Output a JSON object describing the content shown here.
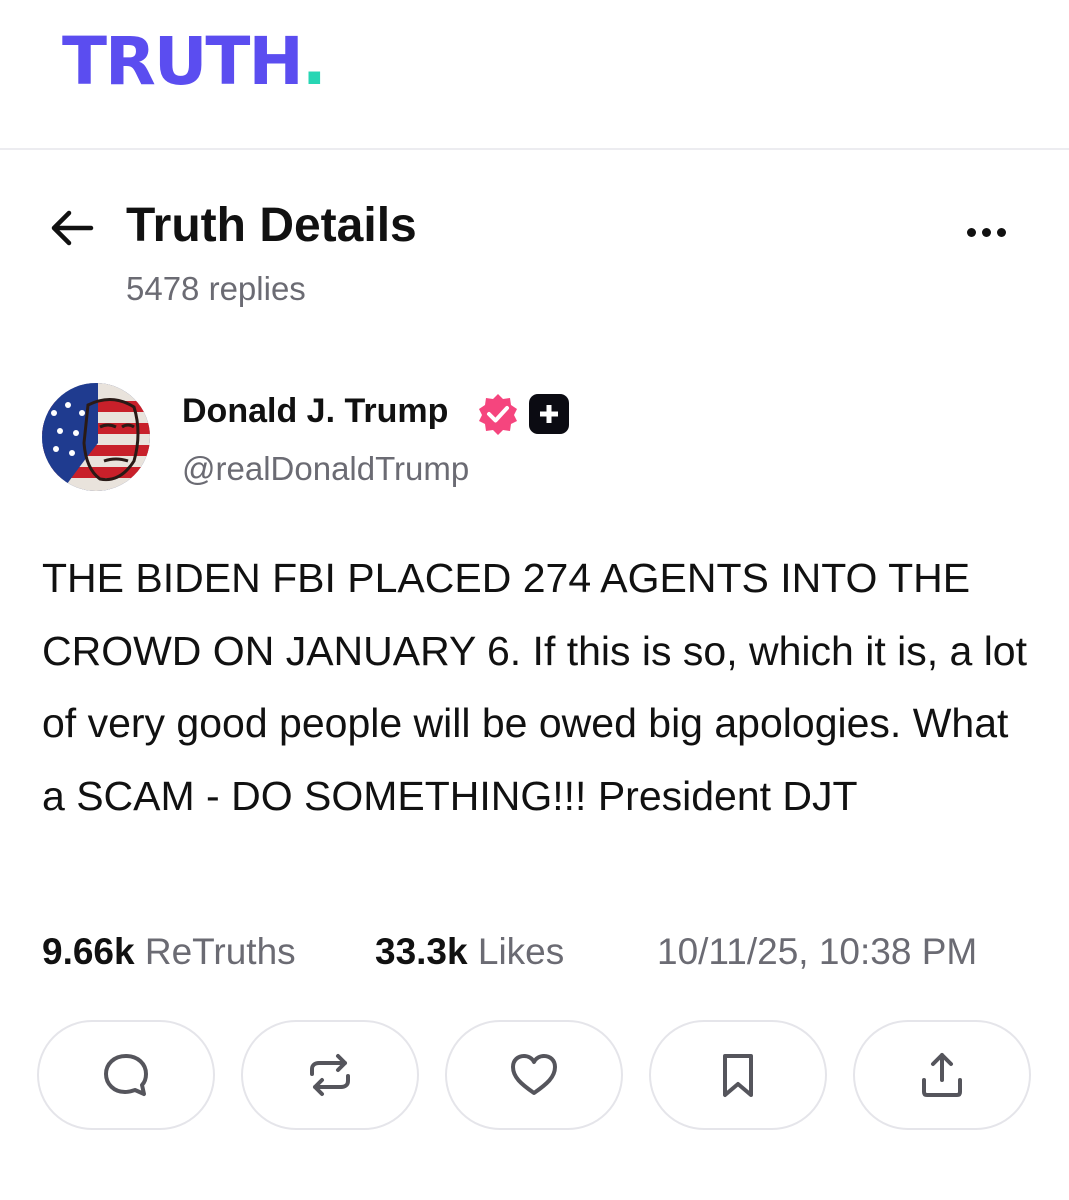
{
  "brand": {
    "logo_text": "TRUTH",
    "logo_dot": ".",
    "brand_color": "#5b4df0",
    "accent_color": "#27d6b4"
  },
  "header": {
    "back_icon": "arrow-left-icon",
    "title": "Truth Details",
    "subtitle": "5478 replies",
    "more_icon": "more-horizontal-icon"
  },
  "post": {
    "author": {
      "name": "Donald J. Trump",
      "handle": "@realDonaldTrump",
      "verified_icon": "verified-badge-icon",
      "verified_color": "#f5457e",
      "plus_icon": "truth-plus-badge-icon"
    },
    "body": "THE BIDEN FBI PLACED 274 AGENTS INTO THE CROWD ON JANUARY 6. If this is so, which it is, a lot of very good people will be owed big apologies. What a SCAM - DO SOMETHING!!! President DJT",
    "stats": {
      "retruths_count": "9.66k",
      "retruths_label": "ReTruths",
      "likes_count": "33.3k",
      "likes_label": "Likes",
      "timestamp": "10/11/25, 10:38 PM"
    }
  },
  "actions": [
    {
      "icon": "reply-icon"
    },
    {
      "icon": "retruth-icon"
    },
    {
      "icon": "like-heart-icon"
    },
    {
      "icon": "bookmark-icon"
    },
    {
      "icon": "share-icon"
    }
  ]
}
